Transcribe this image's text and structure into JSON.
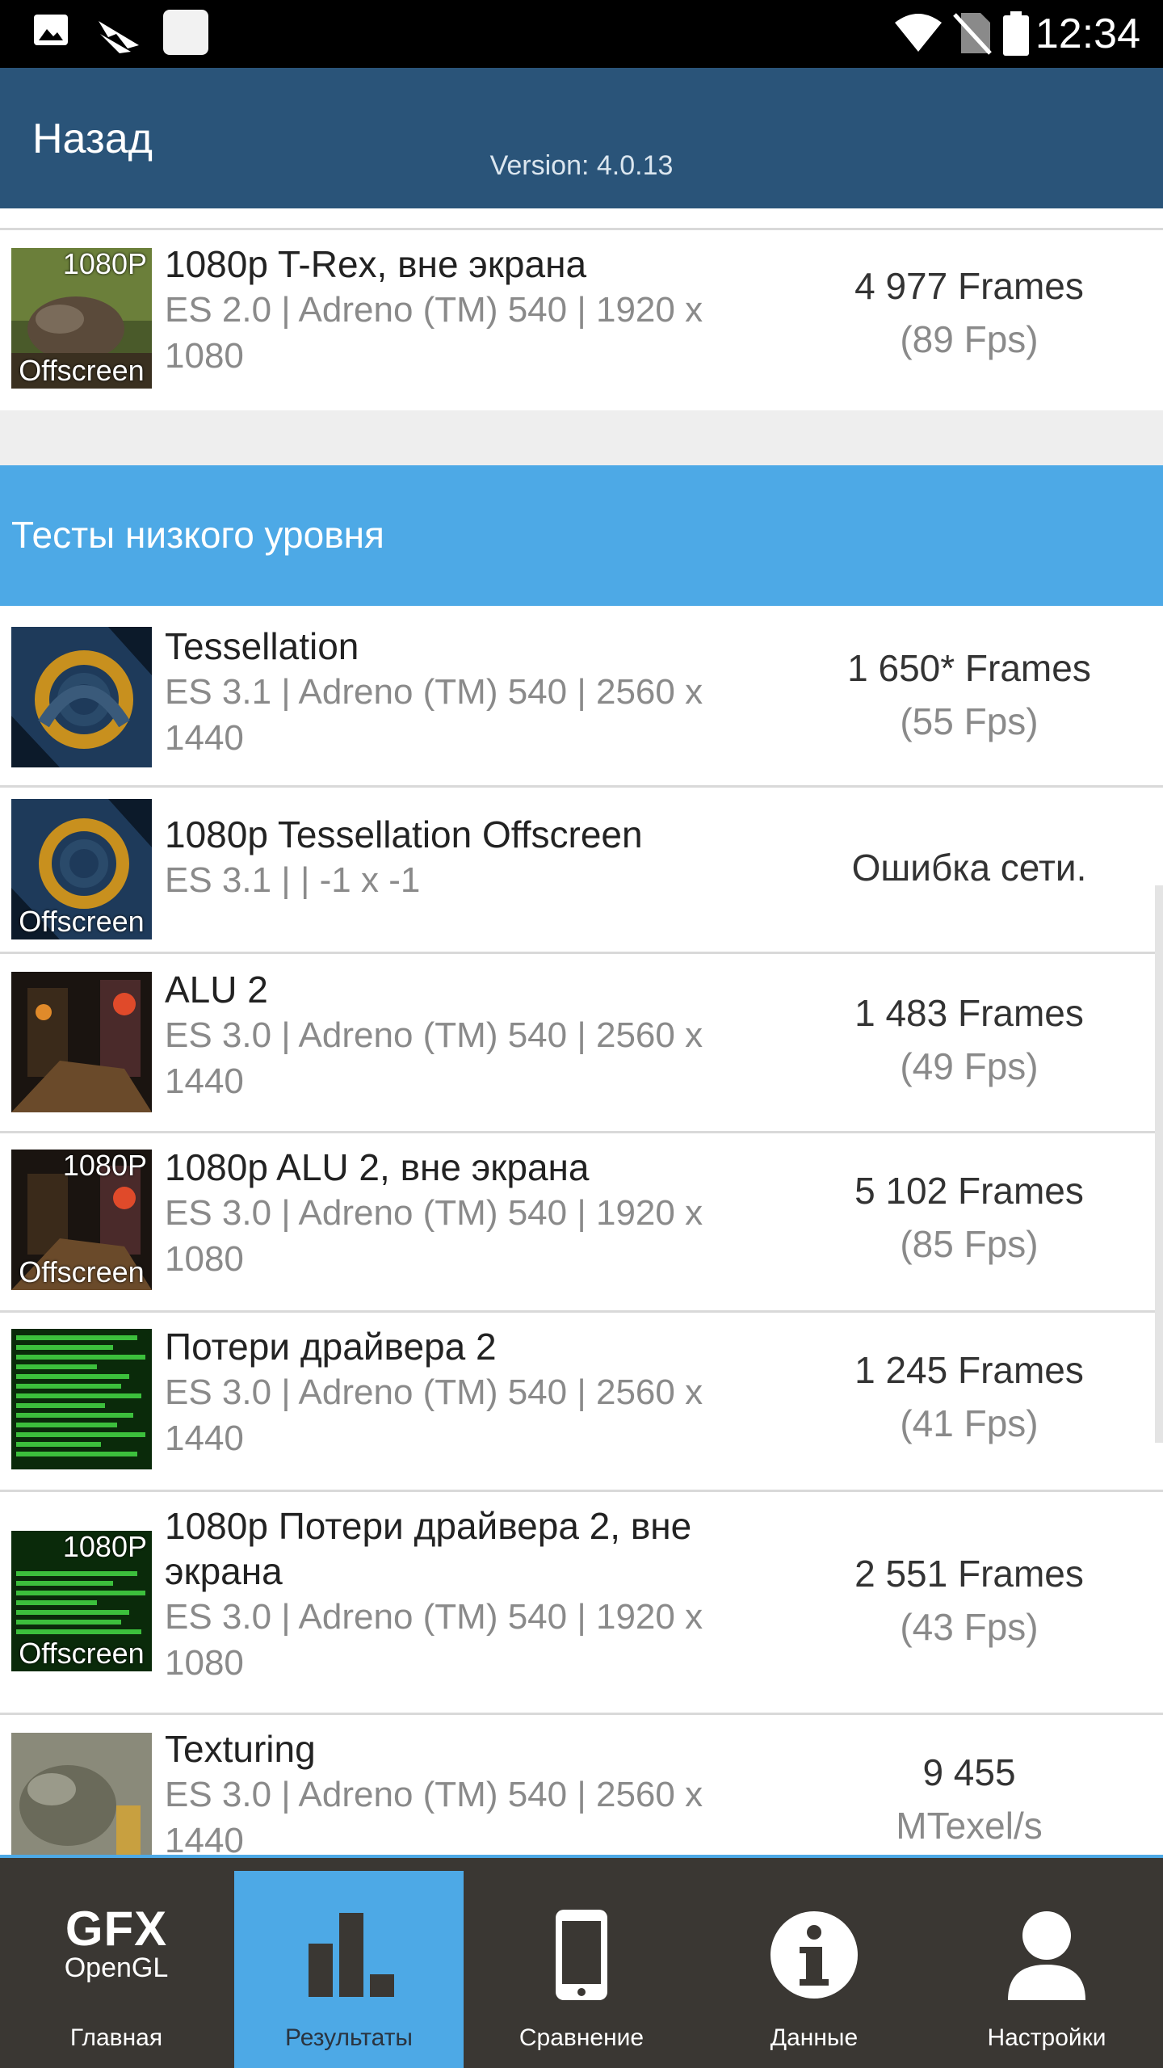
{
  "status_bar": {
    "time": "12:34",
    "left_icons": [
      "gallery-icon",
      "flight-icon",
      "app-icon"
    ],
    "right_icons": [
      "wifi-icon",
      "no-sim-icon",
      "battery-icon"
    ]
  },
  "app_bar": {
    "back_label": "Назад",
    "version": "Version: 4.0.13"
  },
  "rows_top": [
    {
      "title": "1080p T-Rex, вне экрана",
      "subtitle": "ES 2.0 | Adreno (TM) 540 | 1920 x 1080",
      "score": "4 977 Frames",
      "fps": "(89 Fps)",
      "thumb_badge_top": "1080P",
      "thumb_badge_bottom": "Offscreen"
    }
  ],
  "section": {
    "title": "Тесты низкого уровня"
  },
  "rows": [
    {
      "title": "Tessellation",
      "subtitle": "ES 3.1 | Adreno (TM) 540 | 2560 x 1440",
      "score": "1 650* Frames",
      "fps": "(55 Fps)",
      "thumb_badge_top": "",
      "thumb_badge_bottom": ""
    },
    {
      "title": "1080p Tessellation Offscreen",
      "subtitle": "ES 3.1 |  | -1 x -1",
      "score": "Ошибка сети.",
      "fps": "",
      "thumb_badge_top": "",
      "thumb_badge_bottom": "Offscreen"
    },
    {
      "title": "ALU 2",
      "subtitle": "ES 3.0 | Adreno (TM) 540 | 2560 x 1440",
      "score": "1 483 Frames",
      "fps": "(49 Fps)",
      "thumb_badge_top": "",
      "thumb_badge_bottom": ""
    },
    {
      "title": "1080p ALU 2, вне экрана",
      "subtitle": "ES 3.0 | Adreno (TM) 540 | 1920 x 1080",
      "score": "5 102 Frames",
      "fps": "(85 Fps)",
      "thumb_badge_top": "1080P",
      "thumb_badge_bottom": "Offscreen"
    },
    {
      "title": "Потери драйвера 2",
      "subtitle": "ES 3.0 | Adreno (TM) 540 | 2560 x 1440",
      "score": "1 245 Frames",
      "fps": "(41 Fps)",
      "thumb_badge_top": "",
      "thumb_badge_bottom": ""
    },
    {
      "title": "1080p Потери драйвера 2, вне экрана",
      "subtitle": "ES 3.0 | Adreno (TM) 540 | 1920 x 1080",
      "score": "2 551 Frames",
      "fps": "(43 Fps)",
      "thumb_badge_top": "1080P",
      "thumb_badge_bottom": "Offscreen"
    },
    {
      "title": "Texturing",
      "subtitle": "ES 3.0 | Adreno (TM) 540 | 2560 x 1440",
      "score": "9 455",
      "fps": "MTexel/s",
      "thumb_badge_top": "",
      "thumb_badge_bottom": ""
    }
  ],
  "bottom_nav": {
    "items": [
      {
        "label": "Главная",
        "icon": "gfx-opengl-logo",
        "logo_top": "GFX",
        "logo_bottom": "OpenGL",
        "active": false
      },
      {
        "label": "Результаты",
        "icon": "bar-chart-icon",
        "active": true
      },
      {
        "label": "Сравнение",
        "icon": "phone-icon",
        "active": false
      },
      {
        "label": "Данные",
        "icon": "info-icon",
        "active": false
      },
      {
        "label": "Настройки",
        "icon": "user-icon",
        "active": false
      }
    ]
  },
  "colors": {
    "status_bar": "#000000",
    "app_bar": "#2a5479",
    "section_header": "#4da9e6",
    "bottom_nav": "#3a3733",
    "nav_active": "#4da9e6"
  }
}
